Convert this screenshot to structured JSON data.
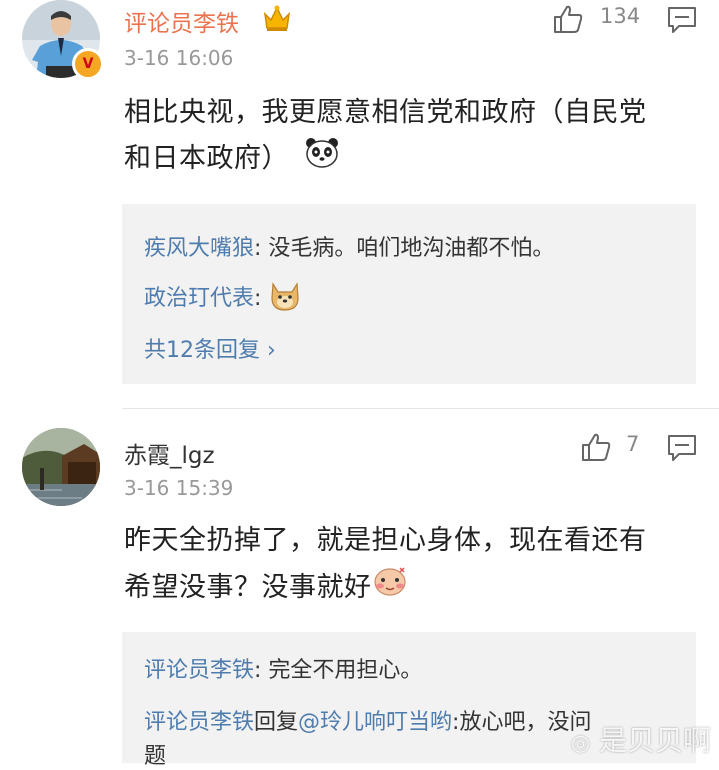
{
  "comments": [
    {
      "username": "评论员李铁",
      "timestamp": "3-16 16:06",
      "likes": "134",
      "verified_badge": "V",
      "text_line1": "相比央视，我更愿意相信党和政府（自民党",
      "text_line2": "和日本政府）",
      "replies": [
        {
          "author": "疾风大嘴狼",
          "sep": ": ",
          "text": "没毛病。咱们地沟油都不怕。"
        },
        {
          "author": "政治玎代表",
          "sep": ": ",
          "text": ""
        }
      ],
      "more_replies": "共12条回复 ›"
    },
    {
      "username": "赤霞_lgz",
      "timestamp": "3-16 15:39",
      "likes": "7",
      "text_line1": "昨天全扔掉了，就是担心身体，现在看还有",
      "text_line2": "希望没事？没事就好",
      "replies": [
        {
          "author": "评论员李铁",
          "sep": ": ",
          "text": "完全不用担心。"
        },
        {
          "author": "评论员李铁",
          "mid": "回复",
          "mention": "@玲儿响叮当哟",
          "sep": ":",
          "text": "放心吧，没问"
        },
        {
          "text": "题"
        }
      ]
    }
  ],
  "watermark": "是贝贝啊"
}
